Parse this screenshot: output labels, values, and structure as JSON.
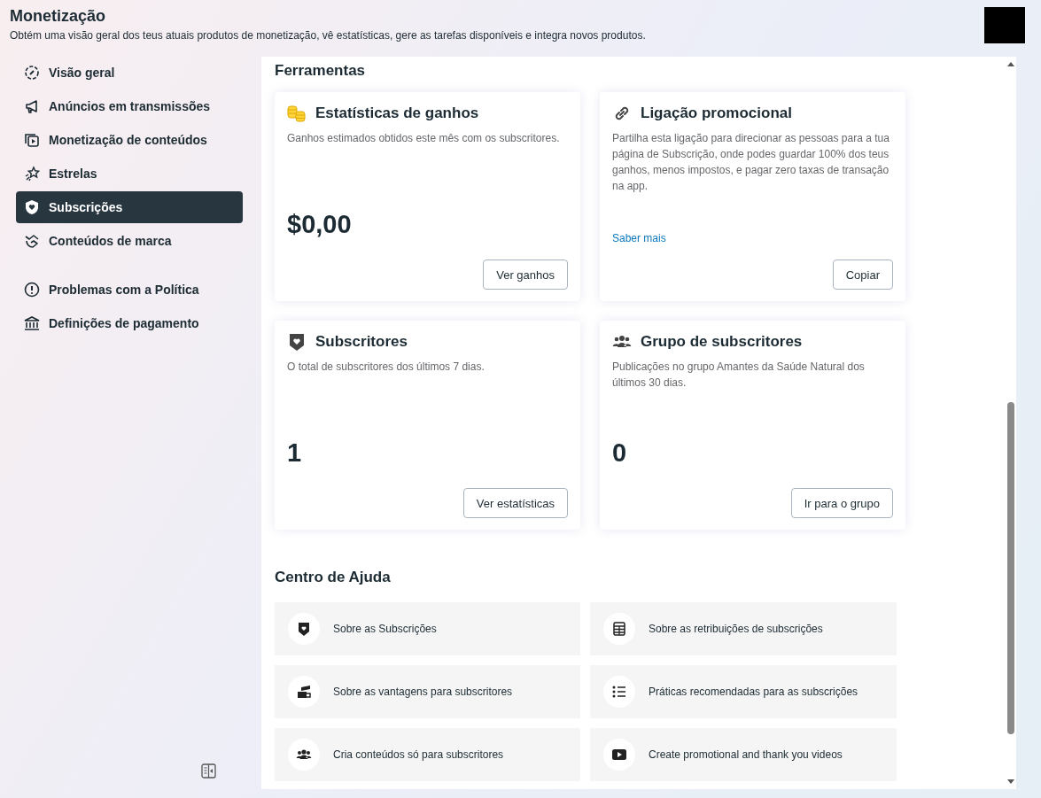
{
  "header": {
    "title": "Monetização",
    "subtitle": "Obtém uma visão geral dos teus atuais produtos de monetização, vê estatísticas, gere as tarefas disponíveis e integra novos produtos."
  },
  "sidebar": {
    "groups": [
      [
        {
          "label": "Visão geral",
          "selected": false
        },
        {
          "label": "Anúncios em transmissões",
          "selected": false
        },
        {
          "label": "Monetização de conteúdos",
          "selected": false
        },
        {
          "label": "Estrelas",
          "selected": false
        },
        {
          "label": "Subscrições",
          "selected": true
        },
        {
          "label": "Conteúdos de marca",
          "selected": false
        }
      ],
      [
        {
          "label": "Problemas com a Política",
          "selected": false
        },
        {
          "label": "Definições de pagamento",
          "selected": false
        }
      ]
    ]
  },
  "tools": {
    "title": "Ferramentas",
    "cards": [
      {
        "title": "Estatísticas de ganhos",
        "description": "Ganhos estimados obtidos este mês com os subscritores.",
        "value": "$0,00",
        "button": "Ver ganhos"
      },
      {
        "title": "Ligação promocional",
        "description": "Partilha esta ligação para direcionar as pessoas para a tua página de Subscrição, onde podes guardar 100% dos teus ganhos, menos impostos, e pagar zero taxas de transação na app.",
        "link": "Saber mais",
        "button": "Copiar"
      },
      {
        "title": "Subscritores",
        "description": "O total de subscritores dos últimos 7 dias.",
        "value": "1",
        "button": "Ver estatísticas"
      },
      {
        "title": "Grupo de subscritores",
        "description": "Publicações no grupo Amantes da Saúde Natural dos últimos 30 dias.",
        "value": "0",
        "button": "Ir para o grupo"
      }
    ]
  },
  "help_center": {
    "title": "Centro de Ajuda",
    "items": [
      "Sobre as Subscrições",
      "Sobre as retribuições de subscrições",
      "Sobre as vantagens para subscritores",
      "Práticas recomendadas para as subscrições",
      "Cria conteúdos só para subscritores",
      "Create promotional and thank you videos"
    ]
  }
}
